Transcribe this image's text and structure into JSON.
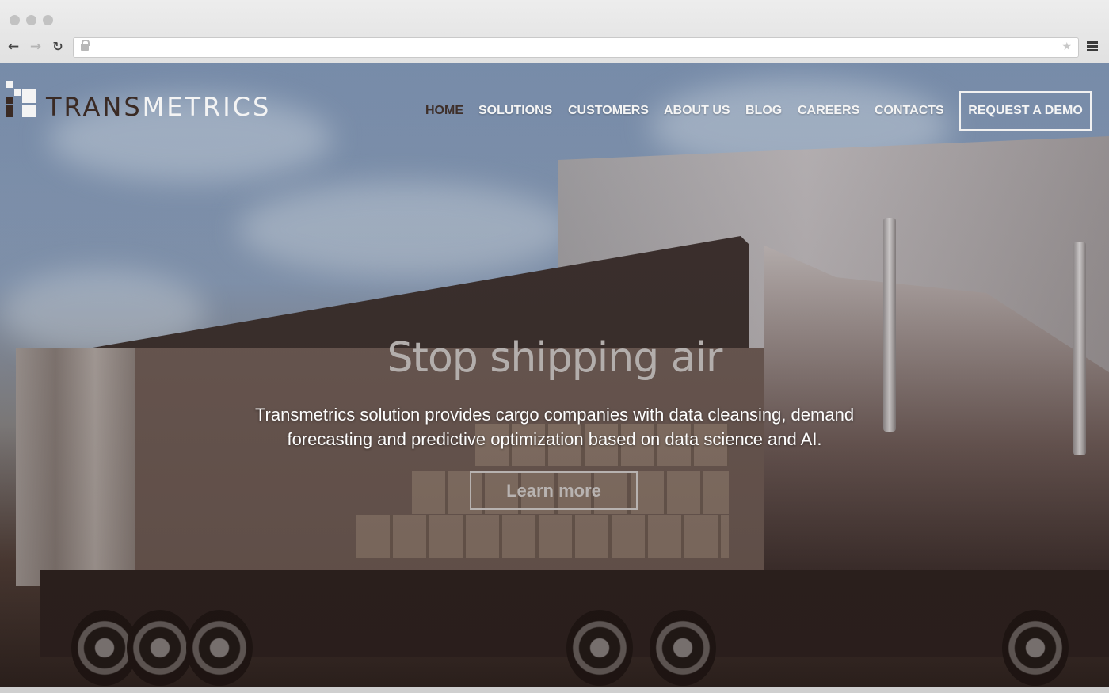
{
  "browser": {
    "url_value": "",
    "icons": {
      "back": "back-arrow-icon",
      "forward": "forward-arrow-icon",
      "reload": "reload-icon",
      "lock": "lock-icon",
      "star": "star-icon",
      "menu": "hamburger-menu-icon"
    },
    "glyphs": {
      "back": "←",
      "forward": "→",
      "reload": "↻",
      "star": "★"
    }
  },
  "site": {
    "logo": {
      "part1": "TRANS",
      "part2": "METRICS"
    },
    "nav": [
      {
        "label": "HOME",
        "active": true
      },
      {
        "label": "SOLUTIONS",
        "active": false
      },
      {
        "label": "CUSTOMERS",
        "active": false
      },
      {
        "label": "ABOUT US",
        "active": false
      },
      {
        "label": "BLOG",
        "active": false
      },
      {
        "label": "CAREERS",
        "active": false
      },
      {
        "label": "CONTACTS",
        "active": false
      }
    ],
    "cta": "REQUEST A DEMO"
  },
  "hero": {
    "title": "Stop shipping air",
    "subtitle_line1": "Transmetrics solution provides cargo companies with data cleansing, demand",
    "subtitle_line2": "forecasting and predictive optimization based on data science and AI.",
    "button": "Learn more"
  },
  "colors": {
    "sky": "#7c93b2",
    "logo_dark": "#3a2a24",
    "nav_active": "#3e2f2a",
    "nav_text": "#f5f5f5",
    "title_text": "#b3aeac"
  }
}
